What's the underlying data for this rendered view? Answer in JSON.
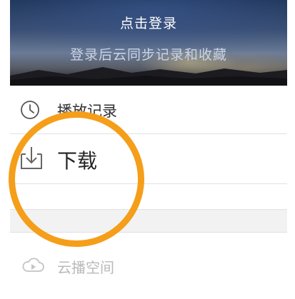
{
  "header": {
    "login_label": "点击登录",
    "subtitle": "登录后云同步记录和收藏"
  },
  "menu": [
    {
      "label": "播放记录",
      "icon": "clock-icon"
    },
    {
      "label": "下载",
      "icon": "download-icon"
    },
    {
      "label": "云播空间",
      "icon": "cloud-play-icon"
    }
  ],
  "colors": {
    "highlight_ring": "#f59e1a",
    "text": "#333333",
    "faded_text": "#b9b9b9"
  }
}
